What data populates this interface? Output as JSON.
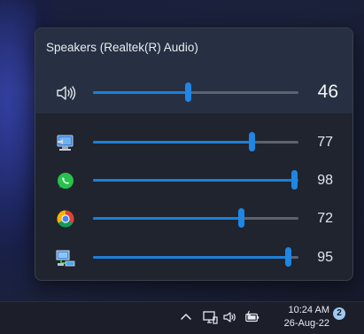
{
  "flyout": {
    "device_name": "Speakers (Realtek(R) Audio)",
    "master": {
      "icon": "speaker-volume-icon",
      "level": 46,
      "value": "46"
    },
    "apps": [
      {
        "icon": "system-sounds-icon",
        "level": 77,
        "value": "77"
      },
      {
        "icon": "whatsapp-icon",
        "level": 98,
        "value": "98"
      },
      {
        "icon": "chrome-icon",
        "level": 72,
        "value": "72"
      },
      {
        "icon": "network-app-icon",
        "level": 95,
        "value": "95"
      }
    ]
  },
  "taskbar": {
    "tray_icons": [
      "chevron-up-icon",
      "network-icon",
      "speaker-icon",
      "battery-charging-icon"
    ],
    "time": "10:24 AM",
    "date": "26-Aug-22",
    "notification_count": "2"
  },
  "colors": {
    "accent": "#1f86e4",
    "flyout_bg": "#20242f",
    "header_bg": "#263042",
    "track": "#5d6270"
  }
}
